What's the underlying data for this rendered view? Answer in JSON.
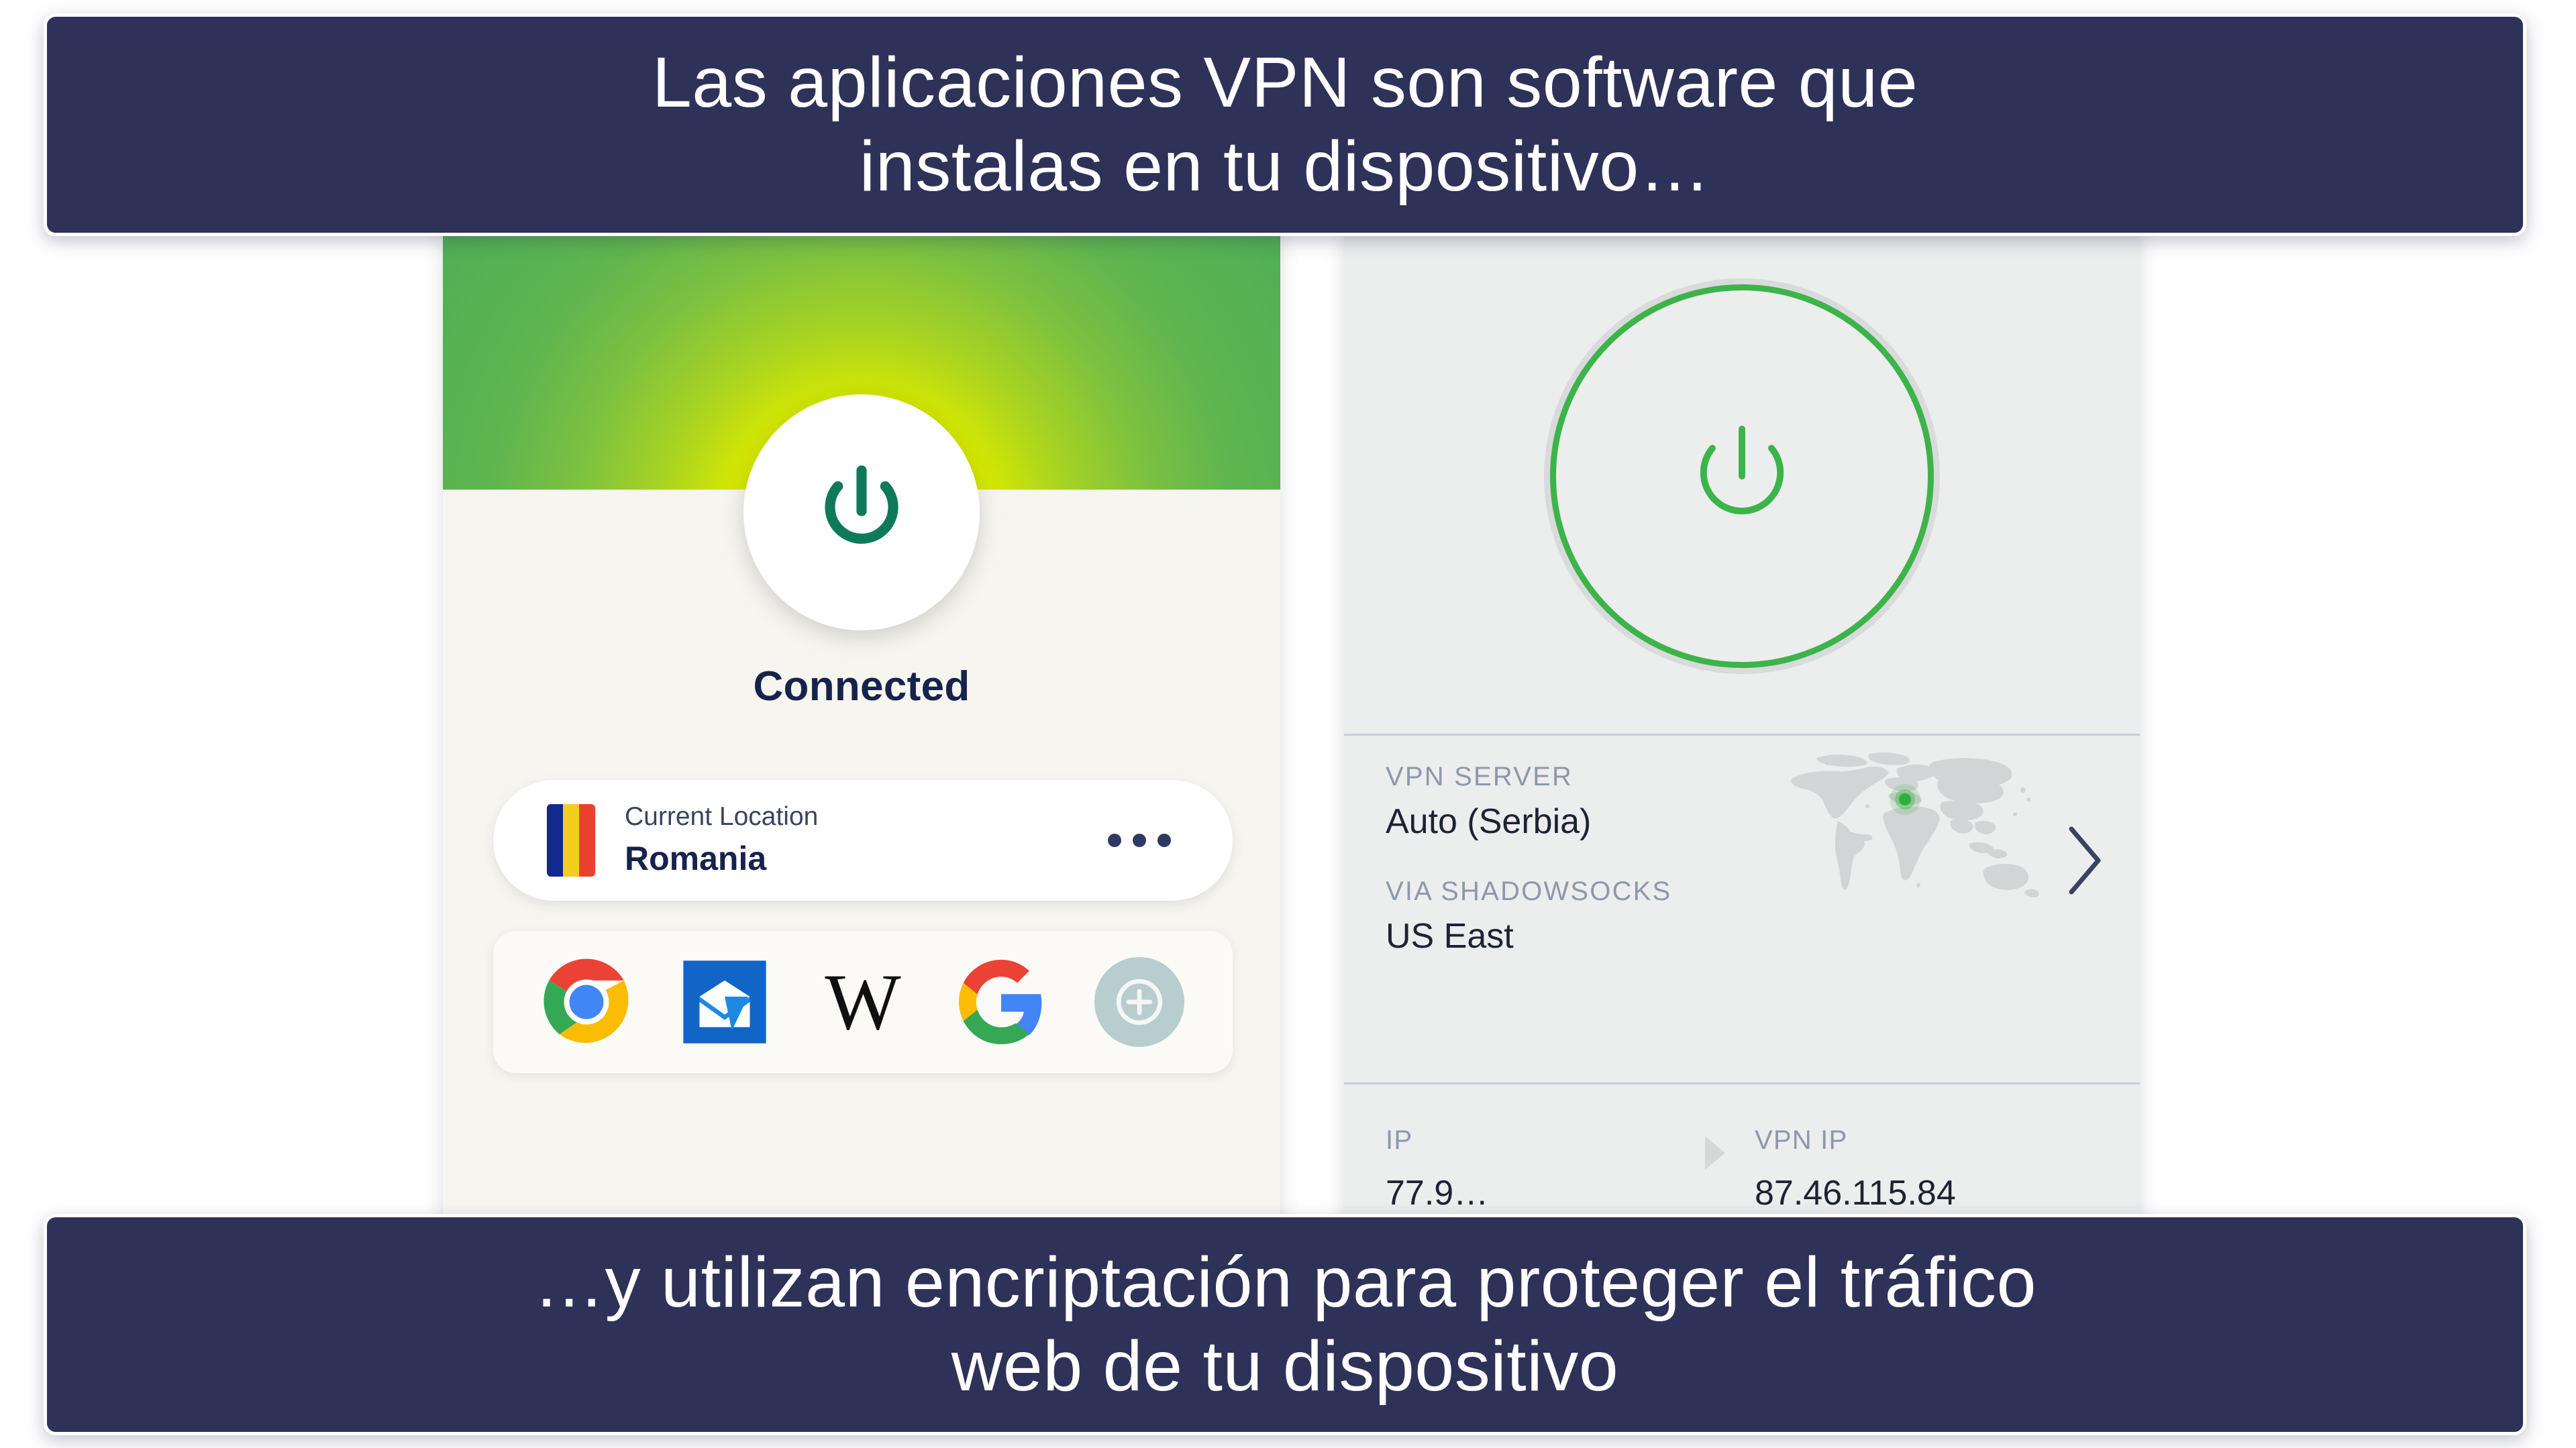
{
  "captions": {
    "top": "Las aplicaciones VPN son software que\ninstalas en tu dispositivo…",
    "bottom": "…y utilizan encriptación para proteger el tráfico\nweb de tu dispositivo"
  },
  "colors": {
    "caption_bg": "#2E3259",
    "caption_text": "#FFFFFF",
    "left_panel_bg": "#F7F5EF",
    "left_hero_green": "#7CC140",
    "left_power_green": "#0F7A5A",
    "right_panel_bg": "#ECEDED",
    "right_ring_green": "#3CB44A",
    "flag_blue": "#14298F",
    "flag_yellow": "#F5CD21",
    "flag_red": "#E9412D"
  },
  "left_app": {
    "power_button_icon": "power-icon",
    "status": "Connected",
    "location_card": {
      "flag_icon": "romania-flag-icon",
      "label": "Current Location",
      "value": "Romania",
      "menu_icon": "more-options-icon"
    },
    "quick_apps": [
      {
        "name": "Google Chrome",
        "icon": "chrome-icon"
      },
      {
        "name": "Mail",
        "icon": "mail-icon"
      },
      {
        "name": "Wikipedia",
        "icon": "wikipedia-icon",
        "glyph": "W"
      },
      {
        "name": "Google",
        "icon": "google-icon"
      },
      {
        "name": "Add shortcut",
        "icon": "add-icon"
      }
    ]
  },
  "right_app": {
    "power_button_icon": "power-icon",
    "server": {
      "kicker": "VPN SERVER",
      "value": "Auto (Serbia)",
      "map_icon": "world-map-icon",
      "location_pin_icon": "location-pin-icon",
      "chevron_icon": "chevron-right-icon"
    },
    "protocol": {
      "kicker": "VIA SHADOWSOCKS",
      "value": "US East"
    },
    "ip_row": {
      "ip_label": "IP",
      "ip_value": "77.9…",
      "arrow_icon": "arrow-right-icon",
      "vpn_ip_label": "VPN IP",
      "vpn_ip_value": "87.46.115.84"
    }
  }
}
